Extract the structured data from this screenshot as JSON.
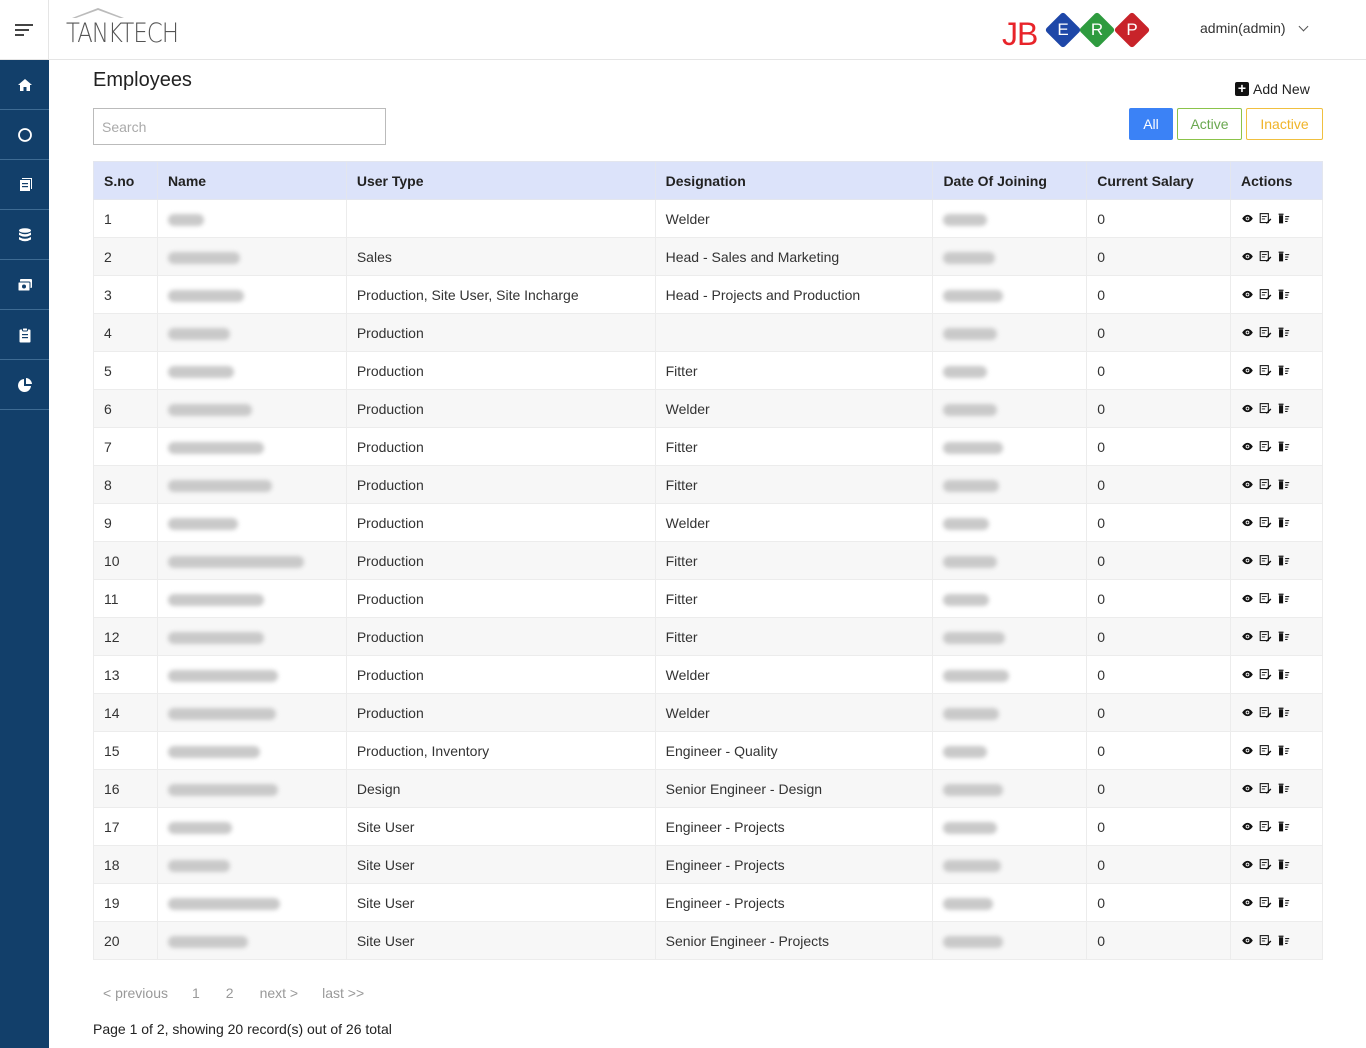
{
  "header": {
    "brand_left": "TANKTECH",
    "brand_right": "JB",
    "erp_letters": [
      "E",
      "R",
      "P"
    ],
    "user": "admin(admin)"
  },
  "sidebar": {
    "items": [
      "home-icon",
      "circle-icon",
      "book-icon",
      "database-icon",
      "money-icon",
      "clipboard-icon",
      "pie-chart-icon"
    ]
  },
  "page": {
    "title": "Employees",
    "add_new": "Add New",
    "search_placeholder": "Search",
    "filters": {
      "all": "All",
      "active": "Active",
      "inactive": "Inactive"
    }
  },
  "table": {
    "headers": [
      "S.no",
      "Name",
      "User Type",
      "Designation",
      "Date Of Joining",
      "Current Salary",
      "Actions"
    ],
    "rows": [
      {
        "sno": "1",
        "type": "",
        "designation": "Welder",
        "salary": "0"
      },
      {
        "sno": "2",
        "type": "Sales",
        "designation": "Head - Sales and Marketing",
        "salary": "0"
      },
      {
        "sno": "3",
        "type": "Production, Site User, Site Incharge",
        "designation": "Head - Projects and Production",
        "salary": "0"
      },
      {
        "sno": "4",
        "type": "Production",
        "designation": "",
        "salary": "0"
      },
      {
        "sno": "5",
        "type": "Production",
        "designation": "Fitter",
        "salary": "0"
      },
      {
        "sno": "6",
        "type": "Production",
        "designation": "Welder",
        "salary": "0"
      },
      {
        "sno": "7",
        "type": "Production",
        "designation": "Fitter",
        "salary": "0"
      },
      {
        "sno": "8",
        "type": "Production",
        "designation": "Fitter",
        "salary": "0"
      },
      {
        "sno": "9",
        "type": "Production",
        "designation": "Welder",
        "salary": "0"
      },
      {
        "sno": "10",
        "type": "Production",
        "designation": "Fitter",
        "salary": "0"
      },
      {
        "sno": "11",
        "type": "Production",
        "designation": "Fitter",
        "salary": "0"
      },
      {
        "sno": "12",
        "type": "Production",
        "designation": "Fitter",
        "salary": "0"
      },
      {
        "sno": "13",
        "type": "Production",
        "designation": "Welder",
        "salary": "0"
      },
      {
        "sno": "14",
        "type": "Production",
        "designation": "Welder",
        "salary": "0"
      },
      {
        "sno": "15",
        "type": "Production, Inventory",
        "designation": "Engineer - Quality",
        "salary": "0"
      },
      {
        "sno": "16",
        "type": "Design",
        "designation": "Senior Engineer - Design",
        "salary": "0"
      },
      {
        "sno": "17",
        "type": "Site User",
        "designation": "Engineer - Projects",
        "salary": "0"
      },
      {
        "sno": "18",
        "type": "Site User",
        "designation": "Engineer - Projects",
        "salary": "0"
      },
      {
        "sno": "19",
        "type": "Site User",
        "designation": "Engineer - Projects",
        "salary": "0"
      },
      {
        "sno": "20",
        "type": "Site User",
        "designation": "Senior Engineer - Projects",
        "salary": "0"
      }
    ]
  },
  "pagination": {
    "previous": "< previous",
    "pages": [
      "1",
      "2"
    ],
    "next": "next >",
    "last": "last >>",
    "info": "Page 1 of 2, showing 20 record(s) out of 26 total"
  },
  "colors": {
    "sidebar": "#123f6a",
    "header_row": "#dce3fa",
    "all_button": "#3b82f6",
    "active_button": "#8bc34a",
    "inactive_button": "#f0c040"
  }
}
